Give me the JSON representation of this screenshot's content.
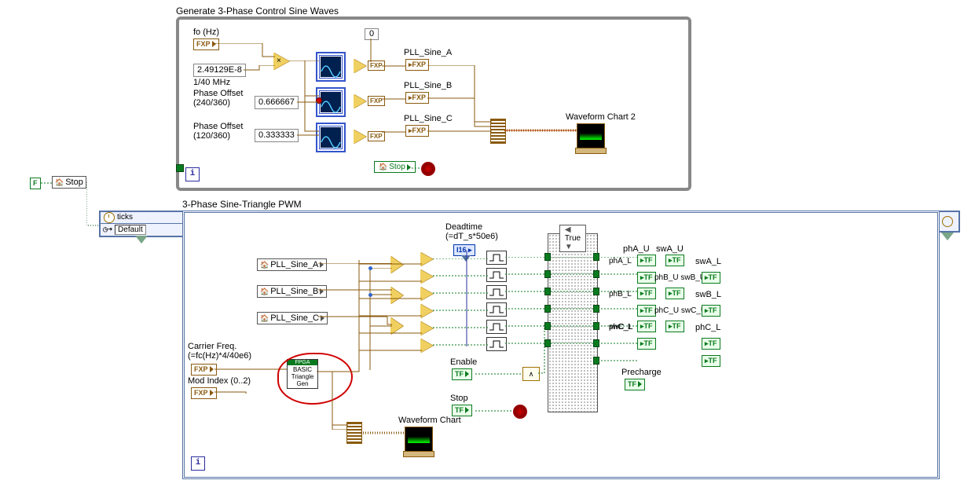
{
  "loop1": {
    "title": "Generate 3-Phase Control Sine Waves",
    "fo_label": "fo (Hz)",
    "fo_const": "2.49129E-8",
    "fo_note": "1/40 MHz",
    "phase240_label": "Phase Offset\n(240/360)",
    "phase240_val": "0.666667",
    "phase120_label": "Phase Offset\n(120/360)",
    "phase120_val": "0.333333",
    "zero": "0",
    "sineA": "PLL_Sine_A",
    "sineB": "PLL_Sine_B",
    "sineC": "PLL_Sine_C",
    "stop_local": "Stop",
    "chart2": "Waveform Chart 2"
  },
  "loop2": {
    "title": "3-Phase Sine-Triangle PWM",
    "ticks": "ticks",
    "timing_src": "Default",
    "locA": "PLL_Sine_A",
    "locB": "PLL_Sine_B",
    "locC": "PLL_Sine_C",
    "carrier_label": "Carrier Freq.\n(=fc(Hz)*4/40e6)",
    "mod_label": "Mod Index (0..2)",
    "subvi_top": "FPGA",
    "subvi_l1": "BASIC",
    "subvi_l2": "Triangle",
    "subvi_l3": "Gen",
    "deadtime_label": "Deadtime\n(=dT_s*50e6)",
    "case_sel": "True",
    "enable": "Enable",
    "stop": "Stop",
    "precharge": "Precharge",
    "chart1": "Waveform Chart",
    "outs": {
      "phA_U": "phA_U",
      "swA_U": "swA_U",
      "phA_L": "phA_L",
      "swA_L": "swA_L",
      "phB_U": "phB_U",
      "swB_U": "swB_U",
      "phB_L": "phB_L",
      "swB_L": "swB_L",
      "phC_U": "phC_U",
      "swC_U": "swC_U",
      "phC_L": "phC_L",
      "swC_L": " ",
      "precharge_ind": ""
    }
  },
  "outer": {
    "stop_local": "Stop",
    "F": "F"
  },
  "glyph": {
    "fxp": "FXP",
    "tf": "TF",
    "i16": "I16",
    "i": "i"
  }
}
